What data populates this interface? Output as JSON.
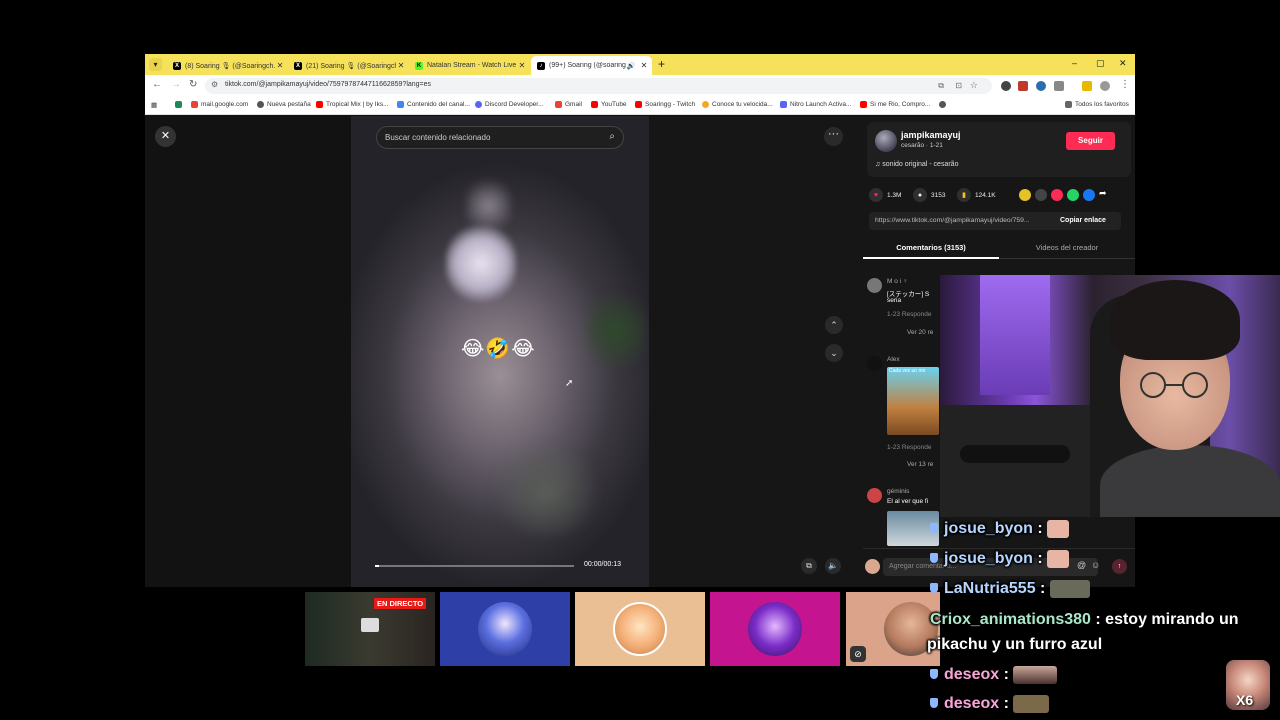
{
  "browser": {
    "tabs": [
      {
        "label": "(8) Soaring 🎙 (@Soaringch...",
        "icon": "x-logo-icon",
        "active": false
      },
      {
        "label": "(21) Soaring 🎙 (@Soaringch...",
        "icon": "x-logo-icon",
        "active": false
      },
      {
        "label": "Natalan Stream - Watch Live o...",
        "icon": "kick-logo-icon",
        "active": false
      },
      {
        "label": "(99+) Soaring (@soaring...",
        "icon": "tiktok-logo-icon",
        "active": true
      }
    ],
    "url": "tiktok.com/@jampikamayuj/video/7597978744711662859?lang=es",
    "bookmarks": [
      {
        "label": "mail.google.com",
        "color": "#ea4335"
      },
      {
        "label": "Nueva pestaña",
        "color": "#555555"
      },
      {
        "label": "Tropical Mix | by Iks...",
        "color": "#ff0000"
      },
      {
        "label": "Contenido del canal...",
        "color": "#4285f4"
      },
      {
        "label": "Discord Developer...",
        "color": "#5865f2"
      },
      {
        "label": "Gmail",
        "color": "#ea4335"
      },
      {
        "label": "YouTube",
        "color": "#ff0000"
      },
      {
        "label": "Soaringg - Twitch",
        "color": "#9146ff"
      },
      {
        "label": "Conoce tu velocida...",
        "color": "#f5a623"
      },
      {
        "label": "Nitro Launch Activa...",
        "color": "#5865f2"
      },
      {
        "label": "Si me Rio, Compro...",
        "color": "#ff0000"
      }
    ],
    "all_favorites": "Todos los favoritos"
  },
  "video": {
    "search_placeholder": "Buscar contenido relacionado",
    "emoji_caption": "😂🤣😂",
    "time": "00:00/00:13",
    "progress": 0.02
  },
  "panel": {
    "creator_name": "jampikamayuj",
    "creator_sub": "cesarão · 1-21",
    "follow_label": "Seguir",
    "sound": "♫  sonido original - cesarão",
    "likes": "1.3M",
    "comments": "3153",
    "saves": "124.1K",
    "link": "https://www.tiktok.com/@jampikamayuj/video/759...",
    "copy_link": "Copiar enlace",
    "tab_comments": "Comentarios (3153)",
    "tab_creator": "Videos del creador",
    "comment1_user": "M o i ♀",
    "comment1_text": "[ステッカー] S",
    "comment1_text2": "seria",
    "comment1_meta": "1-23    Responde",
    "comment1_more": "Ver 20 re",
    "comment2_user": "Alex",
    "comment2_sticker": "Cada ves un mo",
    "comment2_meta": "1-23    Responde",
    "comment2_more": "Ver 13 re",
    "comment3_user": "géminis",
    "comment3_text": "El al ver que fi",
    "comment_placeholder": "Agregar comentario..."
  },
  "tiles": {
    "live_badge": "EN DIRECTO"
  },
  "chat": [
    {
      "user": "josue_byon",
      "sep": " :",
      "msg": ""
    },
    {
      "user": "josue_byon",
      "sep": " :",
      "msg": ""
    },
    {
      "user": "LaNutria555",
      "sep": " :",
      "msg": ""
    },
    {
      "user": "Criox_animations380",
      "sep": " :",
      "msg": " estoy mirando un"
    },
    {
      "user": "",
      "sep": "",
      "msg": "pikachu y un furro azul"
    },
    {
      "user": "deseox",
      "sep": " :",
      "msg": ""
    },
    {
      "user": "deseox",
      "sep": " :",
      "msg": ""
    }
  ],
  "overlay": {
    "x6": "X6"
  },
  "colors": {
    "tiktok_red": "#fe2c55",
    "tab_bar": "#f6e25a",
    "live_red": "#e91916"
  }
}
